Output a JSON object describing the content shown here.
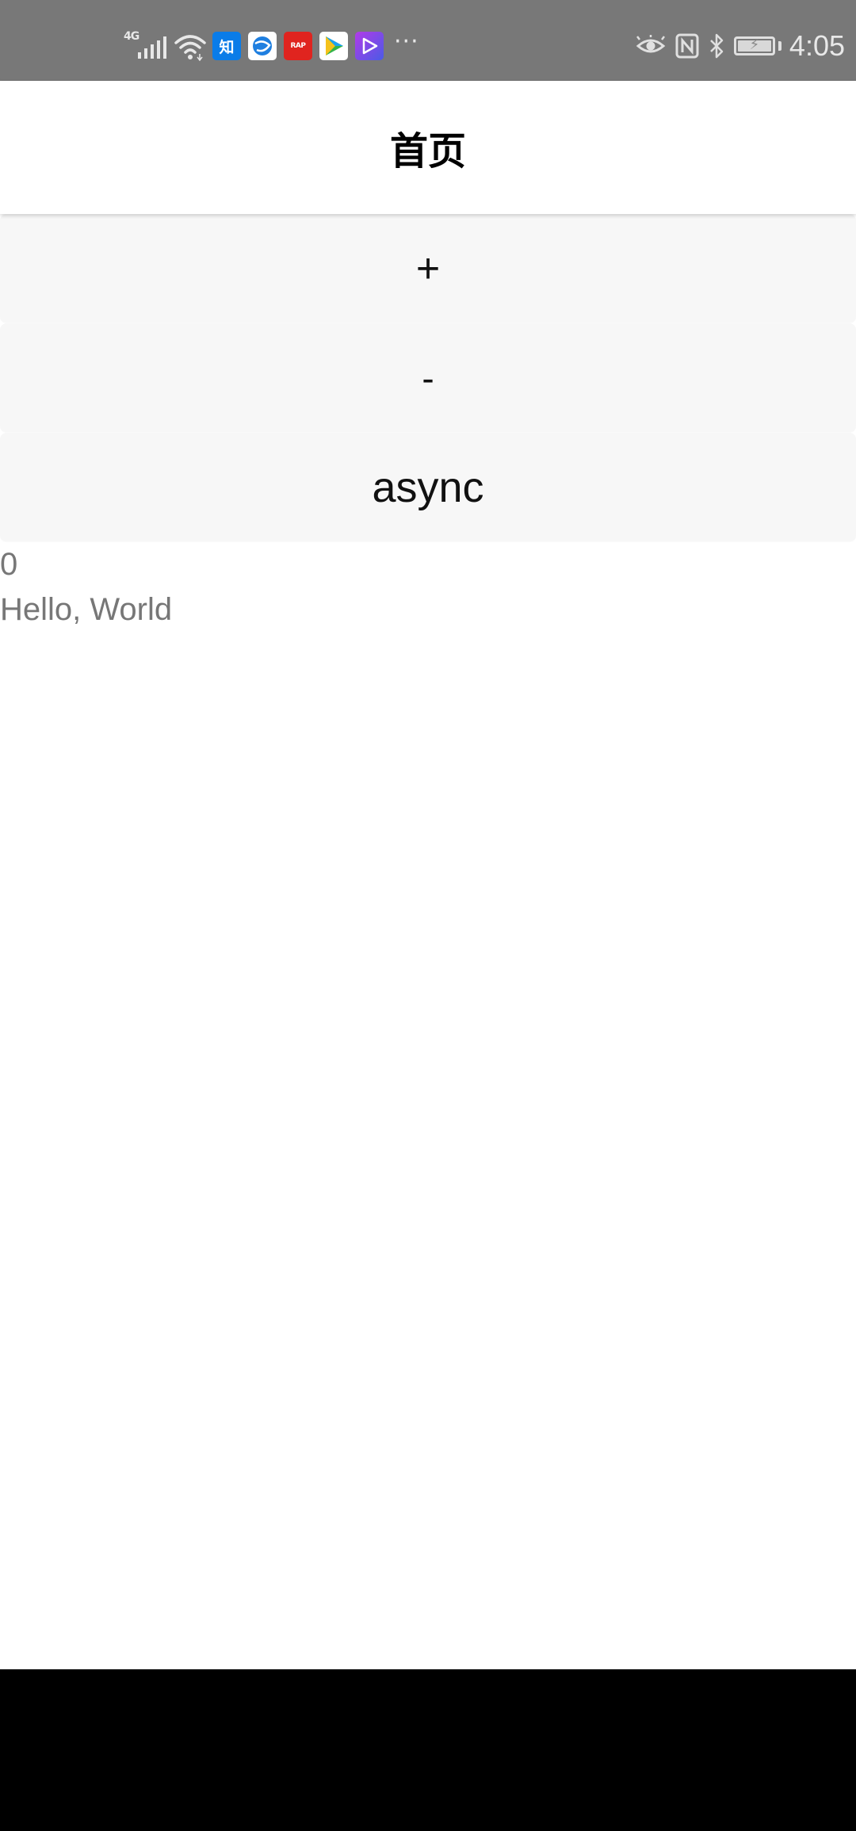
{
  "status_bar": {
    "network_type": "4G",
    "time": "4:05",
    "more_indicator": "···",
    "notification_icons": [
      "zhihu-app-icon",
      "browser-app-icon",
      "red-app-icon",
      "play-app-icon",
      "video-app-icon"
    ],
    "zhihu_label": "知",
    "red_app_label": "RAP"
  },
  "header": {
    "title": "首页"
  },
  "buttons": {
    "increment_label": "+",
    "decrement_label": "-",
    "async_label": "async"
  },
  "content": {
    "count": "0",
    "message": "Hello, World"
  },
  "colors": {
    "status_bar_bg": "#787878",
    "button_bg": "#f7f7f7",
    "text_secondary": "#777777",
    "zhihu_blue": "#0a7ce8",
    "nav_bar_bg": "#000000"
  }
}
